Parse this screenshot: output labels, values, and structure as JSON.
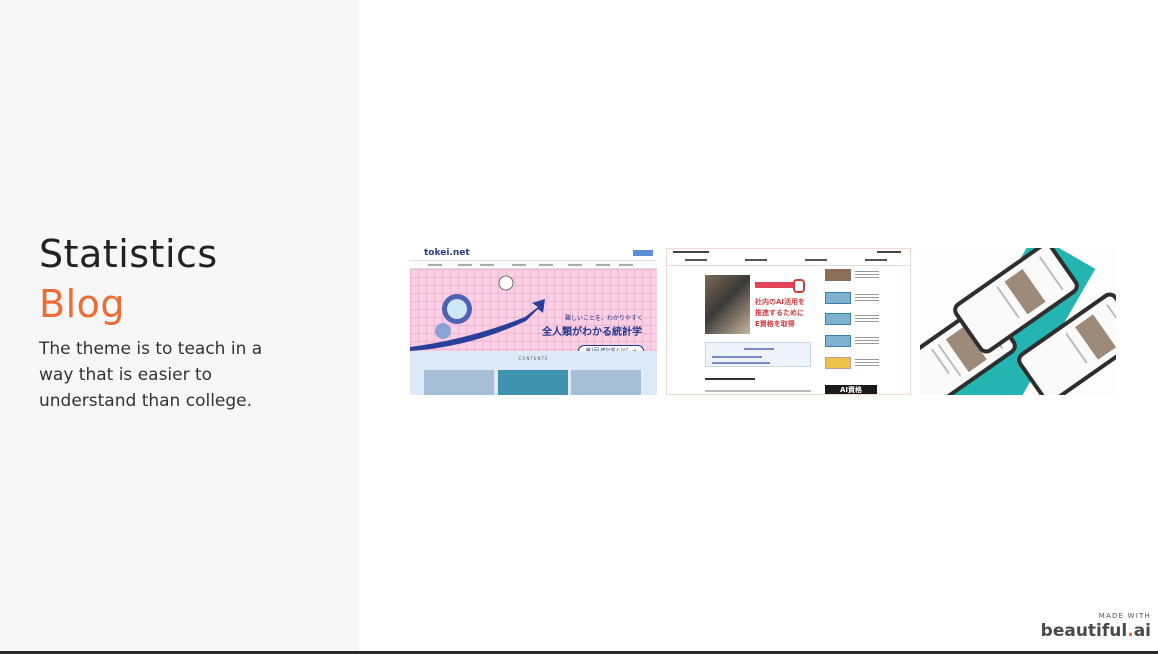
{
  "slide": {
    "title_line1": "Statistics",
    "title_line2": "Blog",
    "description": "The theme is to teach in a way that is easier to understand than college.",
    "accent_color": "#ee6b36"
  },
  "screenshots": [
    {
      "logo": "tokei.net",
      "subheadline": "難しいことを、わかりやすく",
      "headline": "全人類がわかる統計学",
      "button": "第1回 統計学とは？ →",
      "section_label": "CONTENTS"
    },
    {
      "headline_line1": "社内のAI活用を",
      "headline_line2": "推進するために",
      "headline_line3": "E資格を取得",
      "badge": "AI資格"
    },
    {}
  ],
  "credit": {
    "small": "MADE WITH",
    "logo_main": "beautiful",
    "logo_dot": ".",
    "logo_suffix": "ai"
  }
}
